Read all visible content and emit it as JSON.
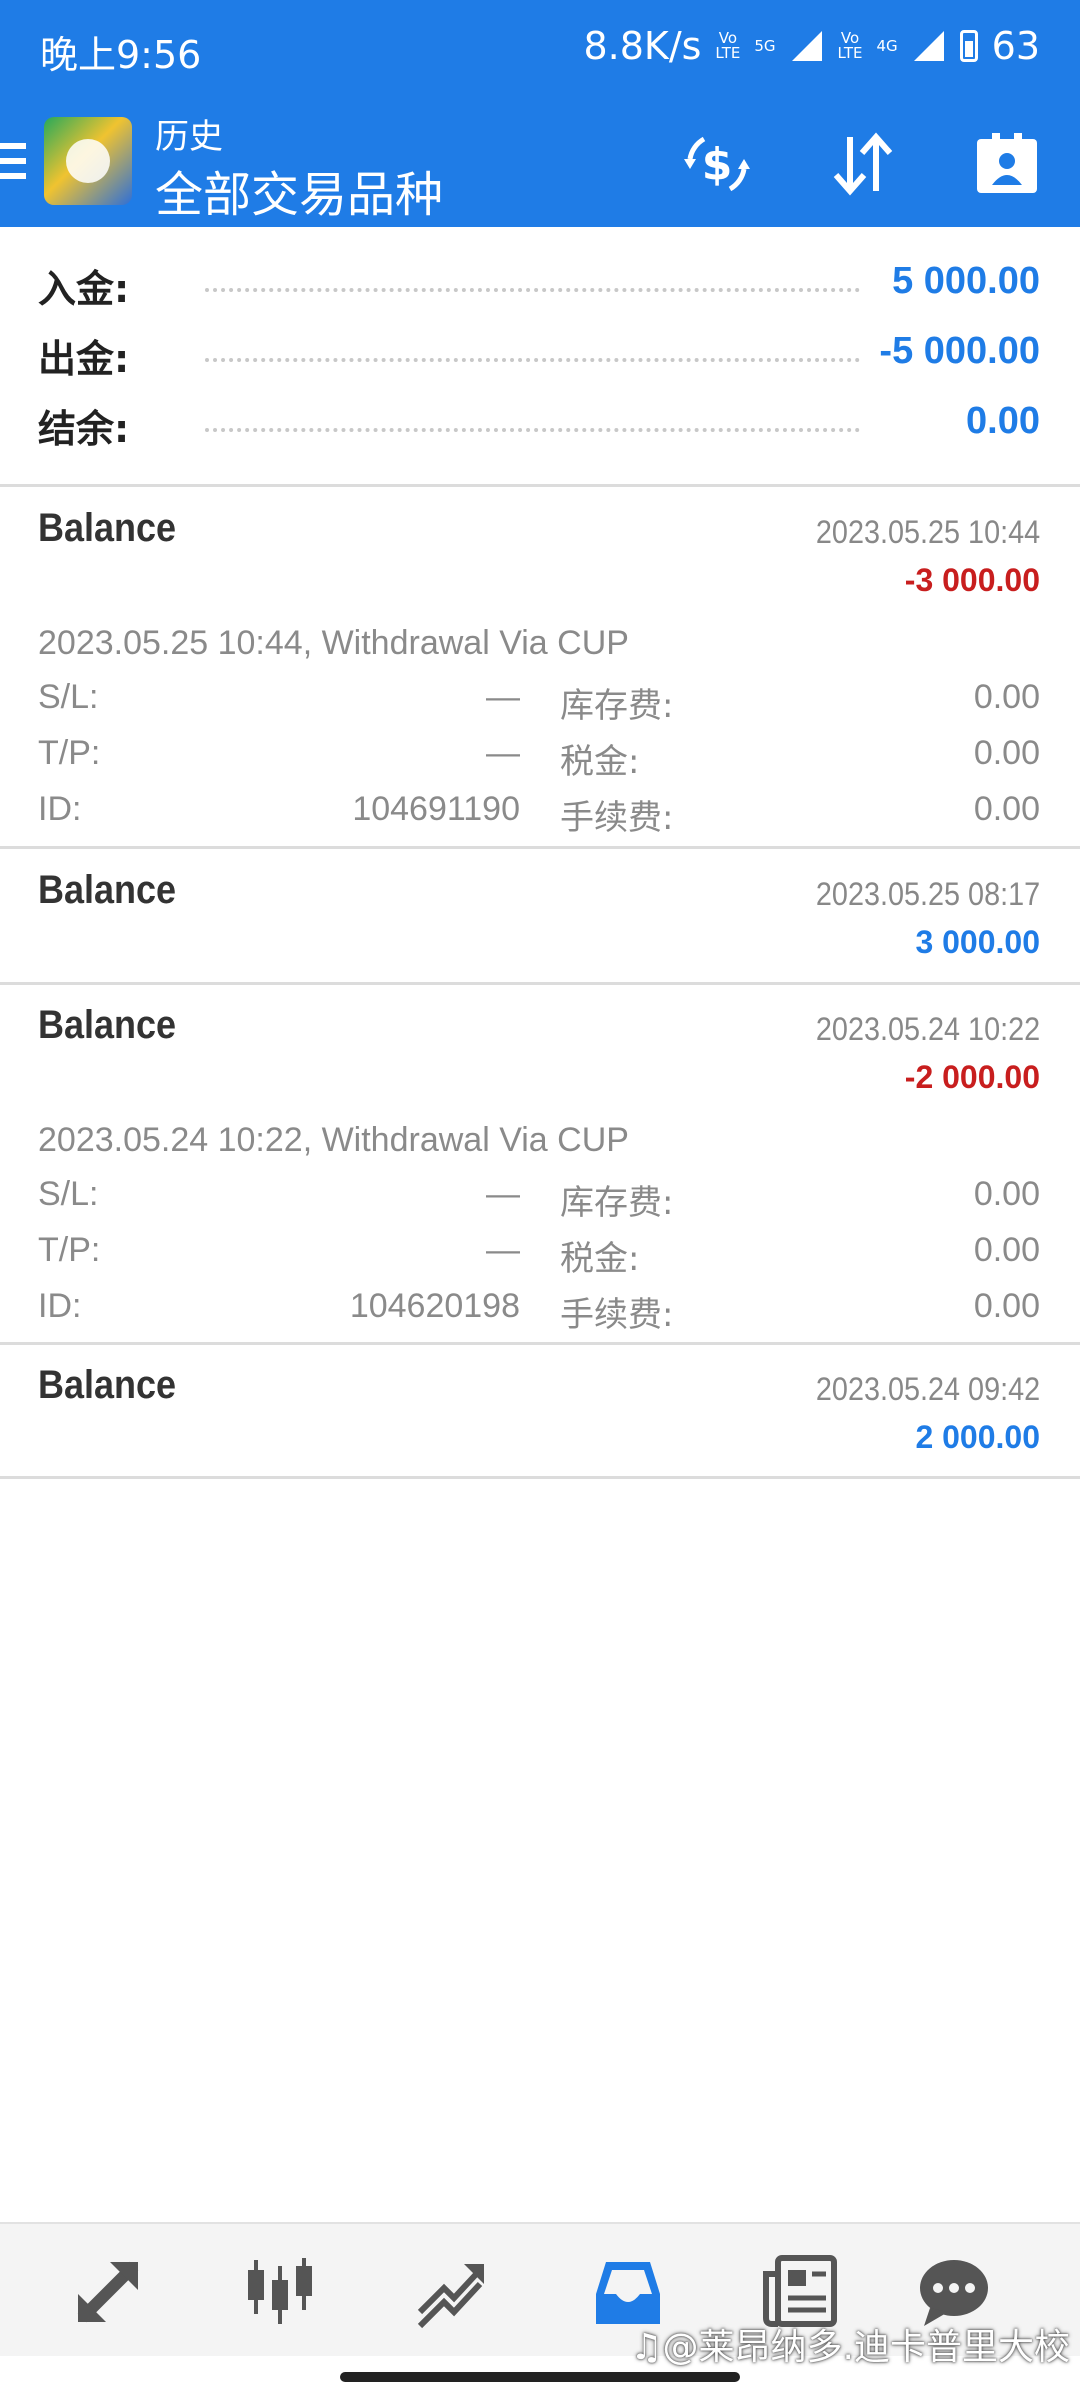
{
  "status_bar": {
    "time": "晚上9:56",
    "net_speed": "8.8K/s",
    "sim1_tag": "5G",
    "sim2_tag": "4G",
    "battery": "63"
  },
  "header": {
    "subtitle": "历史",
    "title": "全部交易品种",
    "icons": [
      "menu-icon",
      "app-logo",
      "currency-exchange-icon",
      "sort-icon",
      "report-icon"
    ]
  },
  "summary": {
    "deposit_label": "入金:",
    "deposit_value": "5 000.00",
    "withdraw_label": "出金:",
    "withdraw_value": "-5 000.00",
    "balance_label": "结余:",
    "balance_value": "0.00"
  },
  "entries": [
    {
      "type": "Balance",
      "date": "2023.05.25 10:44",
      "amount": "-3 000.00",
      "comment": "2023.05.25 10:44, Withdrawal Via CUP",
      "sl_label": "S/L:",
      "sl_value": "—",
      "tp_label": "T/P:",
      "tp_value": "—",
      "id_label": "ID:",
      "id_value": "104691190",
      "swap_label": "库存费:",
      "swap_value": "0.00",
      "tax_label": "税金:",
      "tax_value": "0.00",
      "fee_label": "手续费:",
      "fee_value": "0.00"
    },
    {
      "type": "Balance",
      "date": "2023.05.25 08:17",
      "amount": "3 000.00"
    },
    {
      "type": "Balance",
      "date": "2023.05.24 10:22",
      "amount": "-2 000.00",
      "comment": "2023.05.24 10:22, Withdrawal Via CUP",
      "sl_label": "S/L:",
      "sl_value": "—",
      "tp_label": "T/P:",
      "tp_value": "—",
      "id_label": "ID:",
      "id_value": "104620198",
      "swap_label": "库存费:",
      "swap_value": "0.00",
      "tax_label": "税金:",
      "tax_value": "0.00",
      "fee_label": "手续费:",
      "fee_value": "0.00"
    },
    {
      "type": "Balance",
      "date": "2023.05.24 09:42",
      "amount": "2 000.00"
    }
  ],
  "bottom_nav": {
    "items": [
      "quotes-icon",
      "chart-icon",
      "trade-icon",
      "history-icon",
      "news-icon",
      "chat-icon"
    ],
    "active": "history-icon"
  },
  "watermark": "@莱昂纳多.迪卡普里大校",
  "colors": {
    "accent": "#1f7ce6",
    "negative": "#c81e1e"
  }
}
